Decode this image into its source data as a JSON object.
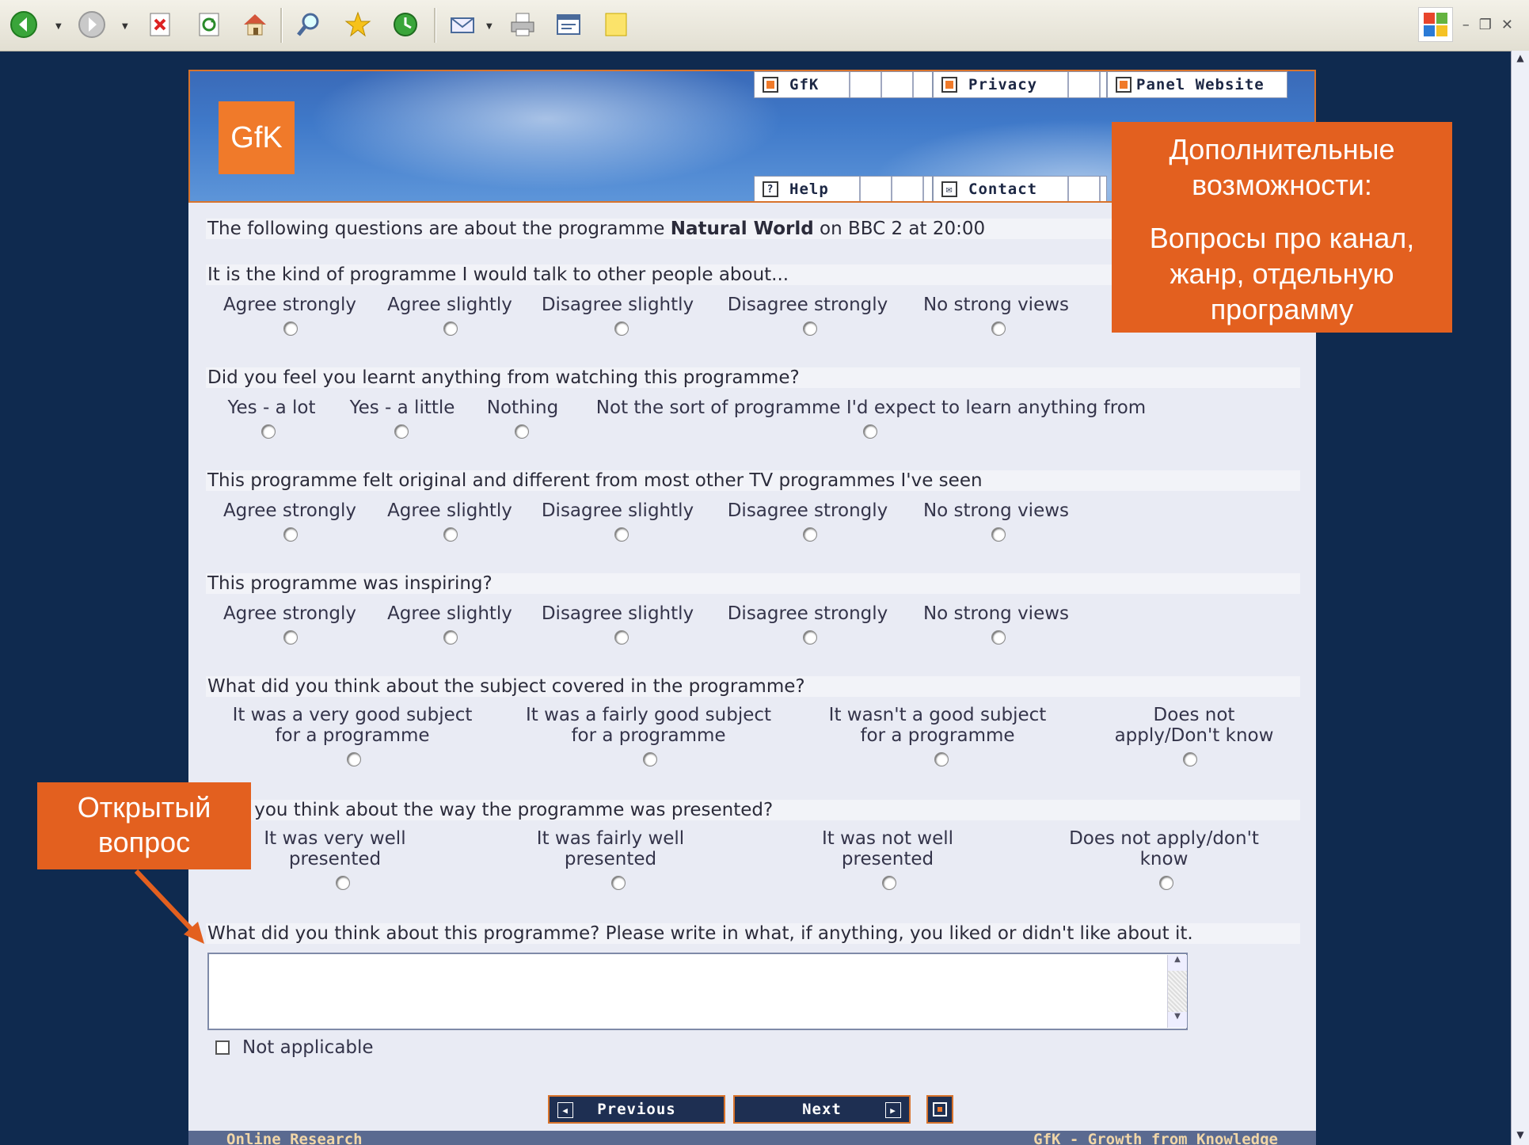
{
  "banner": {
    "logo": "GfK",
    "tabs": [
      {
        "label": "GfK"
      },
      {
        "label": "Privacy"
      },
      {
        "label": "Panel Website"
      },
      {
        "label": "Help"
      },
      {
        "label": "Contact"
      }
    ]
  },
  "intro": {
    "prefix": "The following questions are about the programme ",
    "programme": "Natural World",
    "suffix": " on BBC 2 at 20:00"
  },
  "questions": [
    {
      "text": "It is the kind of programme I would talk to other people about...",
      "options": [
        "Agree strongly",
        "Agree slightly",
        "Disagree slightly",
        "Disagree strongly",
        "No strong views"
      ]
    },
    {
      "text": "Did you feel you learnt anything from watching this programme?",
      "options": [
        "Yes - a lot",
        "Yes - a little",
        "Nothing",
        "Not the sort of programme I'd expect to learn anything from"
      ]
    },
    {
      "text": "This programme felt original and different from most other TV programmes I've seen",
      "options": [
        "Agree strongly",
        "Agree slightly",
        "Disagree slightly",
        "Disagree strongly",
        "No strong views"
      ]
    },
    {
      "text": "This programme was inspiring?",
      "options": [
        "Agree strongly",
        "Agree slightly",
        "Disagree slightly",
        "Disagree strongly",
        "No strong views"
      ]
    },
    {
      "text": "What did you think about the subject covered in the programme?",
      "options": [
        [
          "It was a very good subject",
          "for a programme"
        ],
        [
          "It was a fairly good subject",
          "for a programme"
        ],
        [
          "It wasn't a good subject",
          "for a programme"
        ],
        [
          "Does not",
          "apply/Don't know"
        ]
      ]
    },
    {
      "text": "t did you think about the way the programme was presented?",
      "options": [
        [
          "It was very well",
          "presented"
        ],
        [
          "It was fairly well",
          "presented"
        ],
        [
          "It was not well",
          "presented"
        ],
        [
          "Does not apply/don't",
          "know"
        ]
      ]
    },
    {
      "text": "What did you think about this programme? Please write in what, if anything, you liked or didn't like about it."
    }
  ],
  "not_applicable": "Not applicable",
  "nav": {
    "previous": "Previous",
    "next": "Next"
  },
  "footer": {
    "left": "Online Research",
    "right": "GfK - Growth from Knowledge"
  },
  "callouts": {
    "right": [
      "Дополнительные",
      "возможности:",
      "Вопросы про канал,",
      "жанр, отдельную",
      "программу"
    ],
    "left": [
      "Открытый",
      "вопрос"
    ]
  },
  "colors": {
    "accent": "#e3601f",
    "background": "#0f2a4f",
    "panel": "#e9ebf4"
  },
  "icons": [
    "back-icon",
    "forward-icon",
    "stop-icon",
    "refresh-icon",
    "home-icon",
    "search-icon",
    "favorites-icon",
    "history-icon",
    "mail-icon",
    "print-icon",
    "edit-icon",
    "note-icon"
  ]
}
